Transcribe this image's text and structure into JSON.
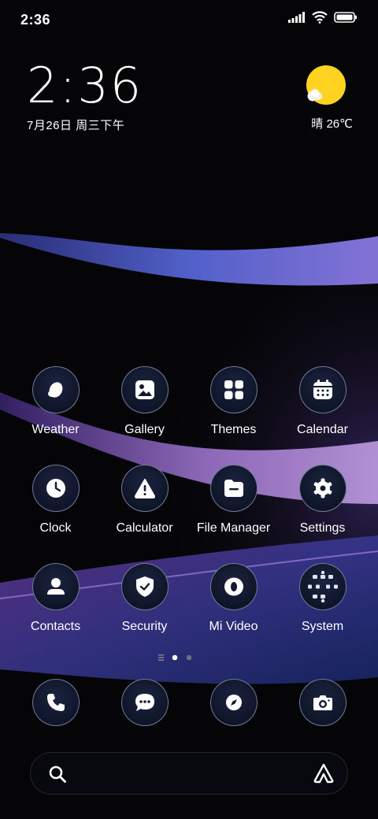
{
  "status_bar": {
    "time": "2:36",
    "icons": [
      "signal-icon",
      "wifi-icon",
      "battery-icon"
    ]
  },
  "clock_widget": {
    "time": "2:36",
    "date": "7月26日 周三下午"
  },
  "weather_widget": {
    "condition": "晴",
    "temperature": "26℃",
    "icon": "sun-cloud-icon"
  },
  "apps": [
    {
      "label": "Weather",
      "icon": "weather-drop-icon"
    },
    {
      "label": "Gallery",
      "icon": "gallery-icon"
    },
    {
      "label": "Themes",
      "icon": "themes-grid-icon"
    },
    {
      "label": "Calendar",
      "icon": "calendar-icon"
    },
    {
      "label": "Clock",
      "icon": "clock-icon"
    },
    {
      "label": "Calculator",
      "icon": "calculator-icon"
    },
    {
      "label": "File Manager",
      "icon": "file-manager-icon"
    },
    {
      "label": "Settings",
      "icon": "settings-gear-icon"
    },
    {
      "label": "Contacts",
      "icon": "contacts-person-icon"
    },
    {
      "label": "Security",
      "icon": "security-shield-icon"
    },
    {
      "label": "Mi Video",
      "icon": "mi-video-icon"
    },
    {
      "label": "System",
      "icon": "system-folder-icon"
    }
  ],
  "page_indicator": {
    "pages": 2,
    "current": 1
  },
  "dock": [
    {
      "name": "phone",
      "icon": "phone-icon"
    },
    {
      "name": "messages",
      "icon": "messages-icon"
    },
    {
      "name": "browser",
      "icon": "compass-icon"
    },
    {
      "name": "camera",
      "icon": "camera-icon"
    }
  ],
  "search_bar": {
    "icon": "search-icon",
    "assistant_icon": "assistant-icon"
  },
  "colors": {
    "background": "#050507",
    "wave_blue": "#5a67d8",
    "wave_purple": "#9b6fd6",
    "sun": "#ffd320",
    "icon_bg": "#131a30"
  }
}
